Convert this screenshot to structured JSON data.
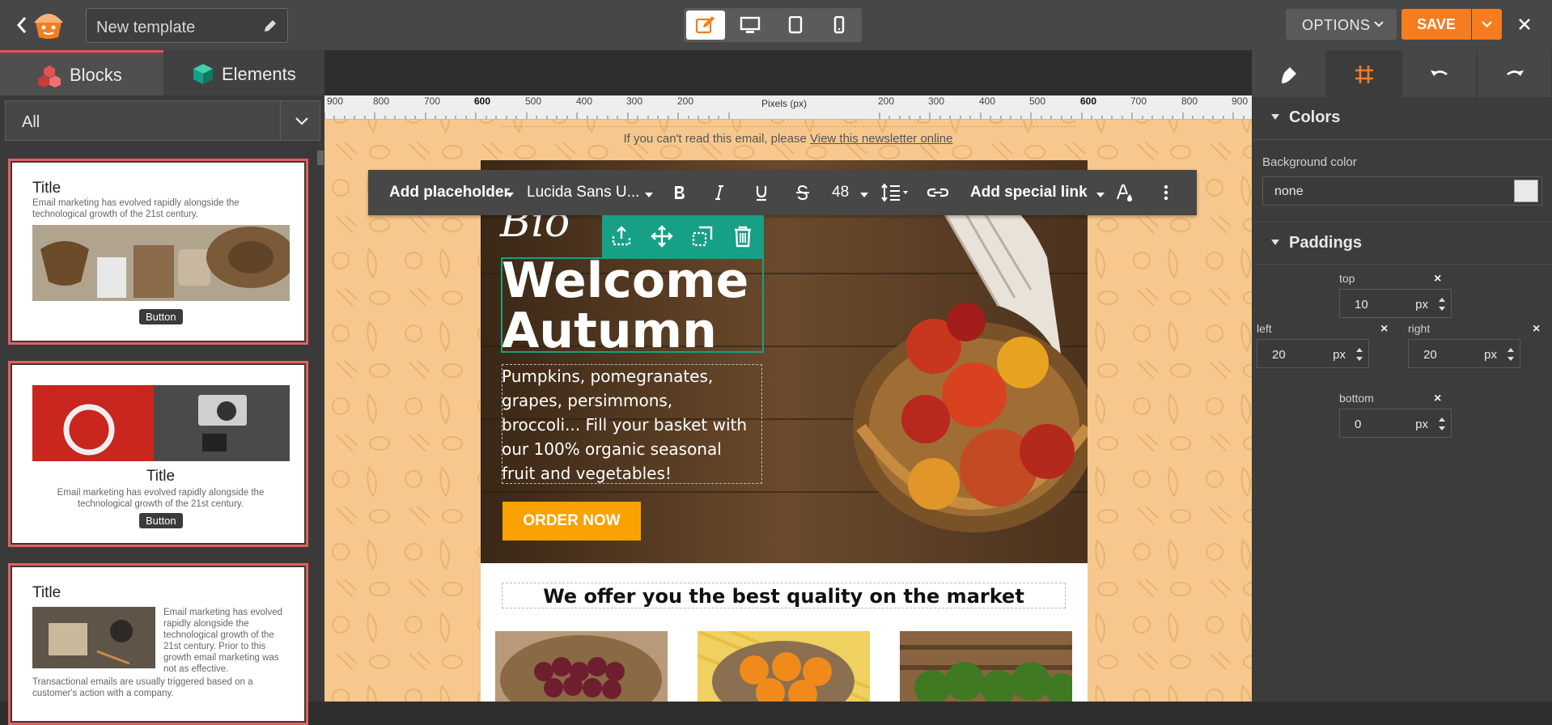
{
  "topbar": {
    "template_name": "New template",
    "options_label": "OPTIONS",
    "save_label": "SAVE"
  },
  "left_panel": {
    "tabs": [
      {
        "label": "Blocks",
        "active": true
      },
      {
        "label": "Elements",
        "active": false
      }
    ],
    "filter_value": "All",
    "blocks": [
      {
        "title": "Title",
        "text": "Email marketing has evolved rapidly alongside the technological growth of the 21st century.",
        "button": "Button"
      },
      {
        "title": "Title",
        "text": "Email marketing has evolved rapidly alongside the technological growth of the 21st century.",
        "button": "Button"
      },
      {
        "title": "Title",
        "text": "Email marketing has evolved rapidly alongside the technological growth of the 21st century. Prior to this growth email marketing was not as effective.",
        "text2": "Transactional emails are usually triggered based on a customer's action with a company."
      }
    ]
  },
  "ruler": {
    "unit_label": "Pixels (px)",
    "ticks_left": [
      "900",
      "800",
      "700",
      "600",
      "500",
      "400",
      "300",
      "200"
    ],
    "ticks_right": [
      "200",
      "300",
      "400",
      "500",
      "600",
      "700",
      "800",
      "900"
    ]
  },
  "canvas": {
    "preheader_text": "If you can't read this email, please ",
    "preheader_link": "View this newsletter online",
    "script_word": "Bio",
    "heading_line1": "Welcome",
    "heading_line2": "Autumn",
    "body_text": "Pumpkins, pomegranates, grapes, persimmons, broccoli... Fill your basket with our 100% organic seasonal fruit and vegetables!",
    "cta_label": "ORDER NOW",
    "offer_title": "We offer you the best quality on the market"
  },
  "format_toolbar": {
    "placeholder_label": "Add placeholder",
    "font_name": "Lucida Sans U...",
    "font_size": "48",
    "special_link_label": "Add special link"
  },
  "right_panel": {
    "colors_heading": "Colors",
    "background_label": "Background color",
    "background_value": "none",
    "paddings_heading": "Paddings",
    "padding": {
      "top_label": "top",
      "top": "10",
      "left_label": "left",
      "left": "20",
      "right_label": "right",
      "right": "20",
      "bottom_label": "bottom",
      "bottom": "0",
      "unit": "px"
    }
  },
  "colors": {
    "accent_orange": "#f57c1f",
    "selection_teal": "#16a085",
    "cta_yellow": "#f9a201",
    "tab_red": "#e85151"
  }
}
